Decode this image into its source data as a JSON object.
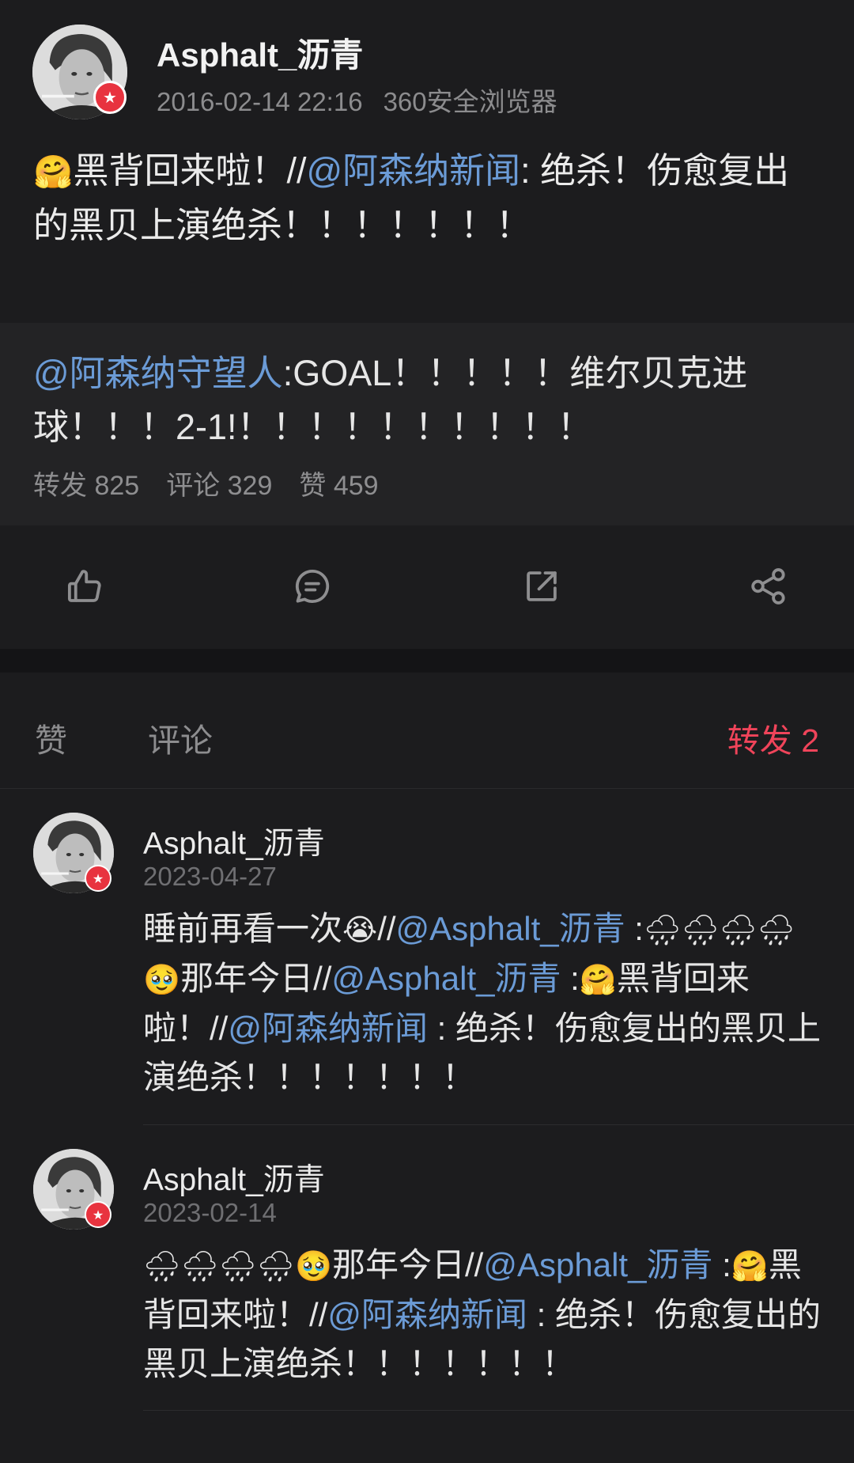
{
  "post": {
    "username": "Asphalt_沥青",
    "timestamp": "2016-02-14 22:16",
    "source": "360安全浏览器",
    "text_prefix_emoji": "🤗",
    "text_part1": "黑背回来啦！//",
    "text_mention": "@阿森纳新闻",
    "text_part2": ": 绝杀！伤愈复出的黑贝上演绝杀！！！！！！！"
  },
  "repost": {
    "mention": "@阿森纳守望人",
    "text": ":GOAL！！！！！维尔贝克进球！！！2-1!！！！！！！！！！！",
    "stats": {
      "reposts": "转发 825",
      "comments": "评论 329",
      "likes": "赞 459"
    }
  },
  "actions": {
    "like_icon": "thumbs-up-icon",
    "comment_icon": "comment-bubble-icon",
    "repost_icon": "share-out-icon",
    "share_icon": "share-nodes-icon"
  },
  "tabs": {
    "likes": "赞",
    "comments": "评论",
    "reposts": "转发 2",
    "active_color": "#f0445a"
  },
  "comments": [
    {
      "username": "Asphalt_沥青",
      "date": "2023-04-27",
      "text_a": "睡前再看一次",
      "emoji_cry": "😭",
      "text_b": "//",
      "mention_1": "@Asphalt_沥青",
      "text_c": " :",
      "emoji_rain": "🌧🌧🌧🌧",
      "emoji_tears": "🥹",
      "text_d": "那年今日//",
      "mention_2": "@Asphalt_沥青",
      "text_e": " :",
      "emoji_hug": "🤗",
      "text_f": "黑背回来啦！//",
      "mention_3": "@阿森纳新闻",
      "text_g": " : 绝杀！伤愈复出的黑贝上演绝杀！！！！！！！"
    },
    {
      "username": "Asphalt_沥青",
      "date": "2023-02-14",
      "emoji_rain": "🌧🌧🌧🌧",
      "emoji_tears": "🥹",
      "text_a": "那年今日//",
      "mention_1": "@Asphalt_沥青",
      "text_b": " :",
      "emoji_hug": "🤗",
      "text_c": "黑背回来啦！//",
      "mention_2": "@阿森纳新闻",
      "text_d": " : 绝杀！伤愈复出的黑贝上演绝杀！！！！！！！"
    }
  ],
  "colors": {
    "mention": "#6b9bd6",
    "verified_badge": "#e8333f",
    "background": "#1c1c1e"
  }
}
